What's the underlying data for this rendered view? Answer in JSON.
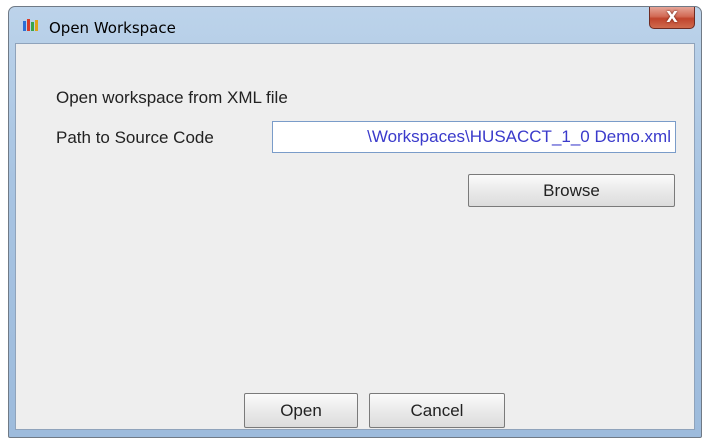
{
  "window": {
    "title": "Open Workspace",
    "close_glyph": "X",
    "app_icon": "husacct-logo-icon"
  },
  "dialog": {
    "heading": "Open workspace from XML file",
    "path_label": "Path to Source Code",
    "path_value": "\\Workspaces\\HUSACCT_1_0 Demo.xml",
    "browse_label": "Browse",
    "open_label": "Open",
    "cancel_label": "Cancel"
  },
  "colors": {
    "path_text": "#3a3acb",
    "close_button": "#c9543d"
  }
}
